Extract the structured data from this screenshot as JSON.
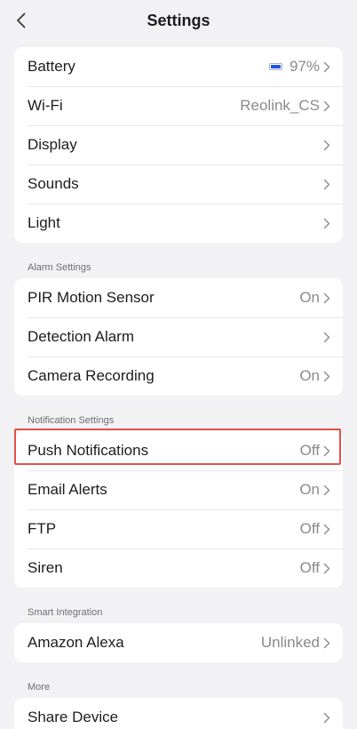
{
  "header": {
    "title": "Settings"
  },
  "sections": [
    {
      "label": "",
      "rows": [
        {
          "label": "Battery",
          "value": "97%",
          "icon": "battery-icon"
        },
        {
          "label": "Wi-Fi",
          "value": "Reolink_CS"
        },
        {
          "label": "Display",
          "value": ""
        },
        {
          "label": "Sounds",
          "value": ""
        },
        {
          "label": "Light",
          "value": ""
        }
      ]
    },
    {
      "label": "Alarm Settings",
      "rows": [
        {
          "label": "PIR Motion Sensor",
          "value": "On"
        },
        {
          "label": "Detection Alarm",
          "value": ""
        },
        {
          "label": "Camera Recording",
          "value": "On"
        }
      ]
    },
    {
      "label": "Notification Settings",
      "rows": [
        {
          "label": "Push Notifications",
          "value": "Off",
          "highlighted": true
        },
        {
          "label": "Email Alerts",
          "value": "On"
        },
        {
          "label": "FTP",
          "value": "Off"
        },
        {
          "label": "Siren",
          "value": "Off"
        }
      ]
    },
    {
      "label": "Smart Integration",
      "rows": [
        {
          "label": "Amazon Alexa",
          "value": "Unlinked"
        }
      ]
    },
    {
      "label": "More",
      "rows": [
        {
          "label": "Share Device",
          "value": ""
        }
      ]
    }
  ],
  "colors": {
    "highlight": "#e0524a",
    "battery": "#1a55e0",
    "background": "#f2f2f4"
  }
}
